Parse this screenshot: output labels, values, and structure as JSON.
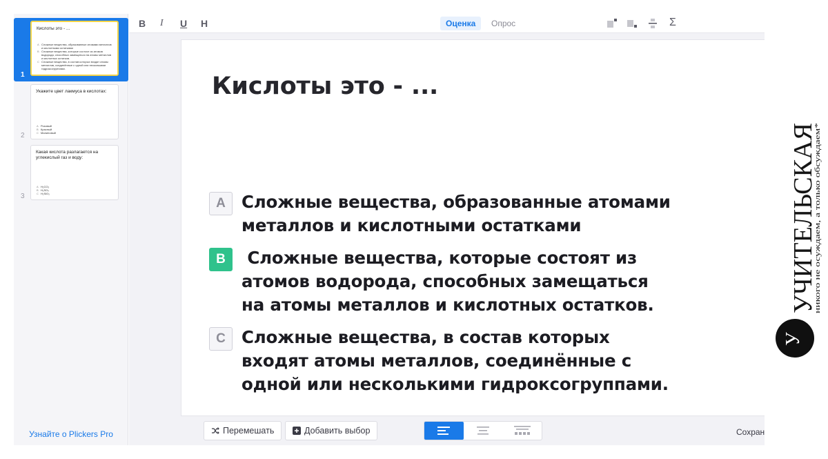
{
  "sidebar": {
    "slides": [
      {
        "number": "1",
        "title": "Кислоты это - ...",
        "choices": [
          {
            "letter": "A",
            "text": "Сложные вещества, образованные атомами металлов и кислотными остатками"
          },
          {
            "letter": "B",
            "text": "Сложные вещества, которые состоят из атомов водорода, способных замещаться на атомы металлов и кислотных остатков."
          },
          {
            "letter": "C",
            "text": "Сложные вещества, в состав которых входят атомы металлов, соединённые с одной или несколькими гидроксогруппами."
          }
        ]
      },
      {
        "number": "2",
        "title": "Укажите цвет лакмуса в кислотах:",
        "choices": [
          {
            "letter": "A",
            "text": "Розовый"
          },
          {
            "letter": "B",
            "text": "Красный"
          },
          {
            "letter": "C",
            "text": "Малиновый"
          }
        ]
      },
      {
        "number": "3",
        "title": "Какая кислота разлагается на углекислый газ и воду:",
        "choices": [
          {
            "letter": "A",
            "text": "H₂CO₃"
          },
          {
            "letter": "B",
            "text": "H₂SO₄"
          },
          {
            "letter": "C",
            "text": "H₂SiO₃"
          }
        ]
      }
    ],
    "promo_link": "Узнайте о Plickers Pro"
  },
  "toolbar": {
    "bold": "B",
    "italic": "I",
    "underline": "U",
    "heading": "H",
    "mode_tabs": [
      "Оценка",
      "Опрос"
    ],
    "active_mode": "Оценка",
    "tools": [
      "image-left-icon",
      "image-right-icon",
      "fraction-icon",
      "sigma-icon"
    ],
    "sigma": "Σ"
  },
  "slide": {
    "question": "Кислоты это - ...",
    "choices": [
      {
        "letter": "A",
        "text": "Сложные вещества, образованные атомами\nметаллов и кислотными остатками",
        "correct": false
      },
      {
        "letter": "B",
        "text": " Сложные вещества, которые состоят из\nатомов водорода, способных замещаться\nна атомы металлов и кислотных остатков.",
        "correct": true
      },
      {
        "letter": "C",
        "text": "Сложные вещества, в состав которых\nвходят атомы металлов, соединённые с\nодной или несколькими гидроксогруппами.",
        "correct": false
      }
    ]
  },
  "bottom_bar": {
    "shuffle_label": "Перемешать",
    "add_choice_label": "Добавить выбор",
    "alignment_options": [
      "align-left-icon",
      "align-center-icon",
      "align-grid-icon"
    ],
    "active_alignment": "align-left-icon",
    "save_status": "Сохран"
  },
  "watermark": {
    "title": "УЧИТЕЛЬСКАЯ",
    "tagline": "никого не осуждаем, а только обсуждаем*",
    "logo_letter": "У"
  },
  "colors": {
    "accent": "#1a7ae8",
    "correct": "#2fc28c",
    "active_thumb_border": "#f5d547"
  }
}
